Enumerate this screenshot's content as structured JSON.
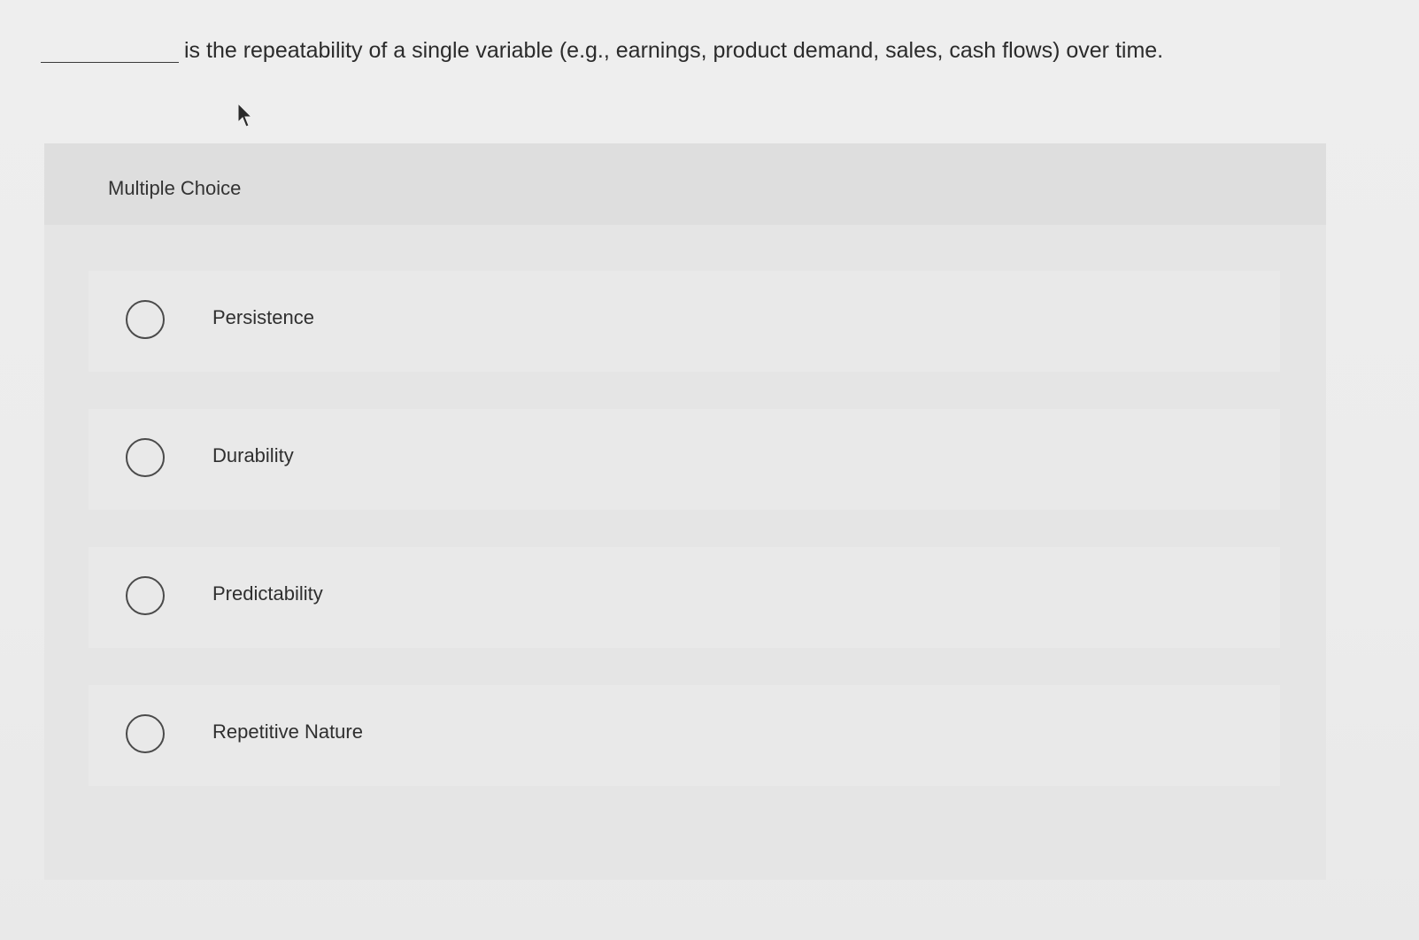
{
  "question": {
    "text": "is the repeatability of a single variable (e.g., earnings, product demand, sales, cash flows) over time."
  },
  "multiple_choice": {
    "header_label": "Multiple Choice",
    "options": [
      {
        "label": "Persistence"
      },
      {
        "label": "Durability"
      },
      {
        "label": "Predictability"
      },
      {
        "label": "Repetitive Nature"
      }
    ]
  },
  "icons": {
    "cursor": "mouse-pointer-icon",
    "radio": "radio-button-unchecked"
  }
}
